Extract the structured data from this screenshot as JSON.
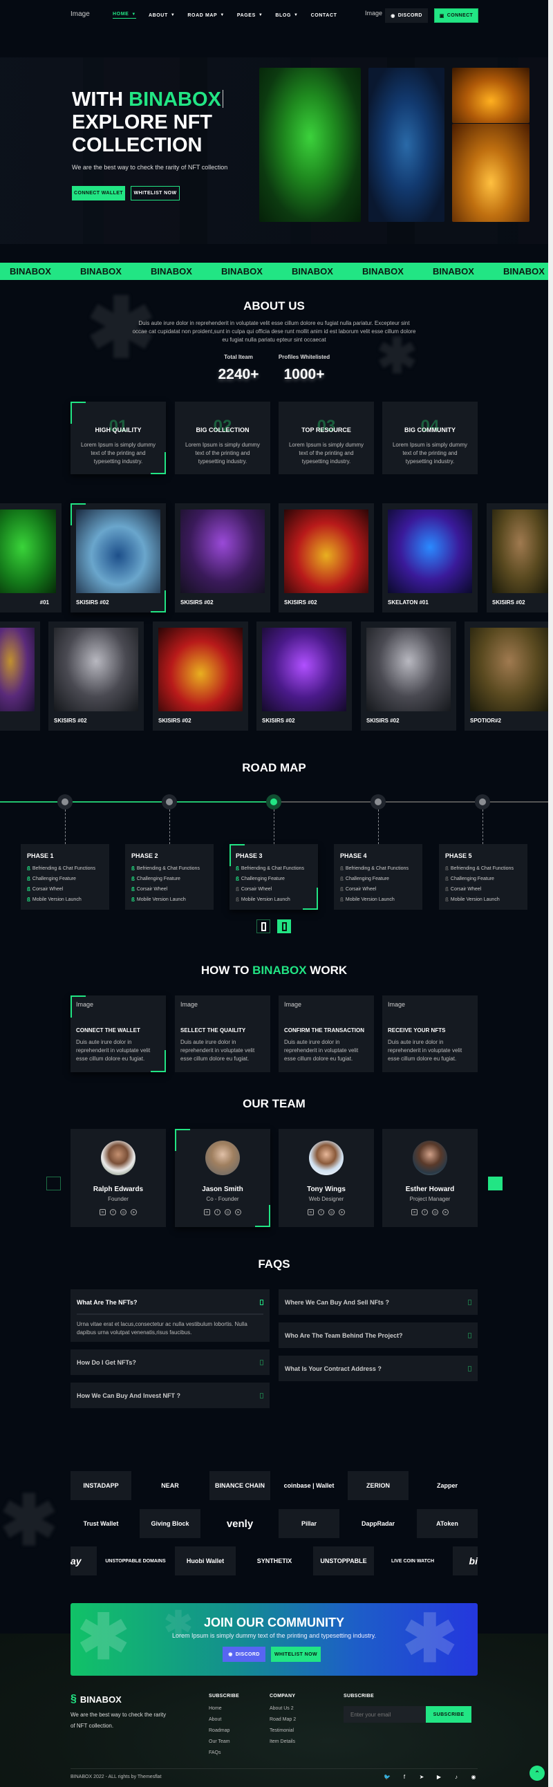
{
  "colors": {
    "accent": "#22e584",
    "background": "#050a12",
    "card": "#151a21",
    "discord": "#5865f2"
  },
  "header": {
    "logo_alt": "Image",
    "nav": [
      {
        "label": "HOME",
        "dropdown": true,
        "active": true
      },
      {
        "label": "ABOUT",
        "dropdown": true
      },
      {
        "label": "ROAD MAP",
        "dropdown": true
      },
      {
        "label": "PAGES",
        "dropdown": true
      },
      {
        "label": "BLOG",
        "dropdown": true
      },
      {
        "label": "CONTACT",
        "dropdown": false
      }
    ],
    "image_alt": "Image",
    "discord_label": "DISCORD",
    "connect_label": "CONNECT"
  },
  "hero": {
    "title_prefix": "WITH ",
    "title_brand": "BINABOX",
    "title_line2": "EXPLORE NFT",
    "title_line3": "COLLECTION",
    "subtitle": "We are the best way to check the rarity of NFT collection",
    "connect_wallet_label": "CONNECT WALLET",
    "whitelist_label": "WHITELIST NOW"
  },
  "ticker": {
    "items": [
      "BINABOX",
      "BINABOX",
      "BINABOX",
      "BINABOX",
      "BINABOX",
      "BINABOX",
      "BINABOX",
      "BINABOX"
    ]
  },
  "about": {
    "title": "ABOUT US",
    "paragraph": "Duis aute irure dolor in reprehenderit in voluptate velit esse cillum dolore eu fugiat nulla pariatur. Excepteur sint occae cat cupidatat non proident,sunt in culpa qui officia dese runt mollit anim id est laborum velit esse cillum dolore eu fugiat nulla pariatu epteur sint occaecat",
    "stats": [
      {
        "label": "Total Iteam",
        "value": "2240+"
      },
      {
        "label": "Profiles Whitelisted",
        "value": "1000+"
      }
    ],
    "features": [
      {
        "number": "01",
        "title": "HIGH QUAILITY",
        "text": "Lorem Ipsum is simply dummy text of the printing and typesetting industry."
      },
      {
        "number": "02",
        "title": "BIG COLLECTION",
        "text": "Lorem Ipsum is simply dummy text of the printing and typesetting industry."
      },
      {
        "number": "03",
        "title": "TOP RESOURCE",
        "text": "Lorem Ipsum is simply dummy text of the printing and typesetting industry."
      },
      {
        "number": "04",
        "title": "BIG COMMUNITY",
        "text": "Lorem Ipsum is simply dummy text of the printing and typesetting industry."
      }
    ]
  },
  "gallery": {
    "row1": [
      "#01",
      "SKISIRS #02",
      "SKISIRS #02",
      "SKISIRS #02",
      "SKELATON #01",
      "SKISIRS #02"
    ],
    "row2": [
      "",
      "SKISIRS #02",
      "SKISIRS #02",
      "SKISIRS #02",
      "SKISIRS #02",
      "SPOTIOR#2"
    ]
  },
  "roadmap": {
    "title": "ROAD MAP",
    "phases": [
      {
        "title": "PHASE 1",
        "items": [
          {
            "text": "Befriending & Chat Functions",
            "done": true
          },
          {
            "text": "Challenging Feature",
            "done": true
          },
          {
            "text": "Corsair Wheel",
            "done": true
          },
          {
            "text": "Mobile Version Launch",
            "done": true
          }
        ]
      },
      {
        "title": "PHASE 2",
        "items": [
          {
            "text": "Befriending & Chat Functions",
            "done": true
          },
          {
            "text": "Challenging Feature",
            "done": true
          },
          {
            "text": "Corsair Wheel",
            "done": true
          },
          {
            "text": "Mobile Version Launch",
            "done": true
          }
        ]
      },
      {
        "title": "PHASE 3",
        "items": [
          {
            "text": "Befriending & Chat Functions",
            "done": true
          },
          {
            "text": "Challenging Feature",
            "done": true
          },
          {
            "text": "Corsair Wheel",
            "done": false
          },
          {
            "text": "Mobile Version Launch",
            "done": false
          }
        ]
      },
      {
        "title": "PHASE 4",
        "items": [
          {
            "text": "Befriending & Chat Functions",
            "done": false
          },
          {
            "text": "Challenging Feature",
            "done": false
          },
          {
            "text": "Corsair Wheel",
            "done": false
          },
          {
            "text": "Mobile Version Launch",
            "done": false
          }
        ]
      },
      {
        "title": "PHASE 5",
        "items": [
          {
            "text": "Befriending & Chat Functions",
            "done": false
          },
          {
            "text": "Challenging Feature",
            "done": false
          },
          {
            "text": "Corsair Wheel",
            "done": false
          },
          {
            "text": "Mobile Version Launch",
            "done": false
          }
        ]
      }
    ],
    "current_phase": 3,
    "page": 2,
    "pages": 2
  },
  "how": {
    "title_prefix": "HOW TO ",
    "title_brand": "BINABOX",
    "title_suffix": " WORK",
    "steps": [
      {
        "image_alt": "Image",
        "title": "CONNECT THE WALLET",
        "text": "Duis aute irure dolor in reprehenderit in voluptate velit esse cillum dolore eu fugiat."
      },
      {
        "image_alt": "Image",
        "title": "SELLECT THE QUAILITY",
        "text": "Duis aute irure dolor in reprehenderit in voluptate velit esse cillum dolore eu fugiat."
      },
      {
        "image_alt": "Image",
        "title": "CONFIRM THE TRANSACTION",
        "text": "Duis aute irure dolor in reprehenderit in voluptate velit esse cillum dolore eu fugiat."
      },
      {
        "image_alt": "Image",
        "title": "RECEIVE YOUR NFTS",
        "text": "Duis aute irure dolor in reprehenderit in voluptate velit esse cillum dolore eu fugiat."
      }
    ]
  },
  "team": {
    "title": "OUR TEAM",
    "members": [
      {
        "name": "Ralph Edwards",
        "role": "Founder"
      },
      {
        "name": "Jason Smith",
        "role": "Co - Founder"
      },
      {
        "name": "Tony Wings",
        "role": "Web Designer"
      },
      {
        "name": "Esther Howard",
        "role": "Project Manager"
      }
    ],
    "social_icons": [
      "linkedin-icon",
      "facebook-icon",
      "instagram-icon",
      "telegram-icon"
    ]
  },
  "faq": {
    "title": "FAQS",
    "left": [
      {
        "question": "What Are The NFTs?",
        "answer": "Urna vitae erat et lacus,consectetur ac nulla vestibulum lobortis. Nulla dapibus urna volutpat venenatis,risus faucibus.",
        "open": true
      },
      {
        "question": "How Do I Get NFTs?"
      },
      {
        "question": "How We Can Buy And Invest NFT ?"
      }
    ],
    "right": [
      {
        "question": "Where We Can Buy And Sell NFts ?"
      },
      {
        "question": "Who Are The Team Behind The Project?"
      },
      {
        "question": "What Is Your Contract Address ?"
      }
    ]
  },
  "partners": {
    "row1": [
      "INSTADAPP",
      "NEAR",
      "BINANCE CHAIN",
      "coinbase | Wallet",
      "ZERION",
      "Zapper"
    ],
    "row2": [
      "Trust Wallet",
      "Giving Block",
      "venly",
      "Pillar",
      "DappRadar",
      "AToken"
    ],
    "row3": [
      "ay",
      "UNSTOPPABLE DOMAINS",
      "Huobi Wallet",
      "SYNTHETIX",
      "UNSTOPPABLE",
      "LIVE COIN WATCH",
      "bi"
    ]
  },
  "community": {
    "title": "JOIN OUR COMMUNITY",
    "text": "Lorem Ipsum is simply dummy text of the printing and typesetting industry.",
    "discord_label": "DISCORD",
    "whitelist_label": "WHITELIST NOW"
  },
  "footer": {
    "brand": "BINABOX",
    "description": "We are the best way to check the rarity of NFT collection.",
    "col1_title": "SUBSCRIBE",
    "col1_links": [
      "Home",
      "About",
      "Roadmap",
      "Our Team",
      "FAQs"
    ],
    "col2_title": "COMPANY",
    "col2_links": [
      "About Us 2",
      "Road Map 2",
      "Testimonial",
      "Item Details"
    ],
    "subscribe_title": "SUBSCRIBE",
    "email_placeholder": "Enter your email",
    "subscribe_label": "SUBSCRIBE",
    "copyright": "BINABOX 2022 - ALL rights by Themesflat",
    "social_icons": [
      "twitter-icon",
      "facebook-icon",
      "telegram-icon",
      "youtube-icon",
      "tiktok-icon",
      "discord-icon"
    ]
  }
}
